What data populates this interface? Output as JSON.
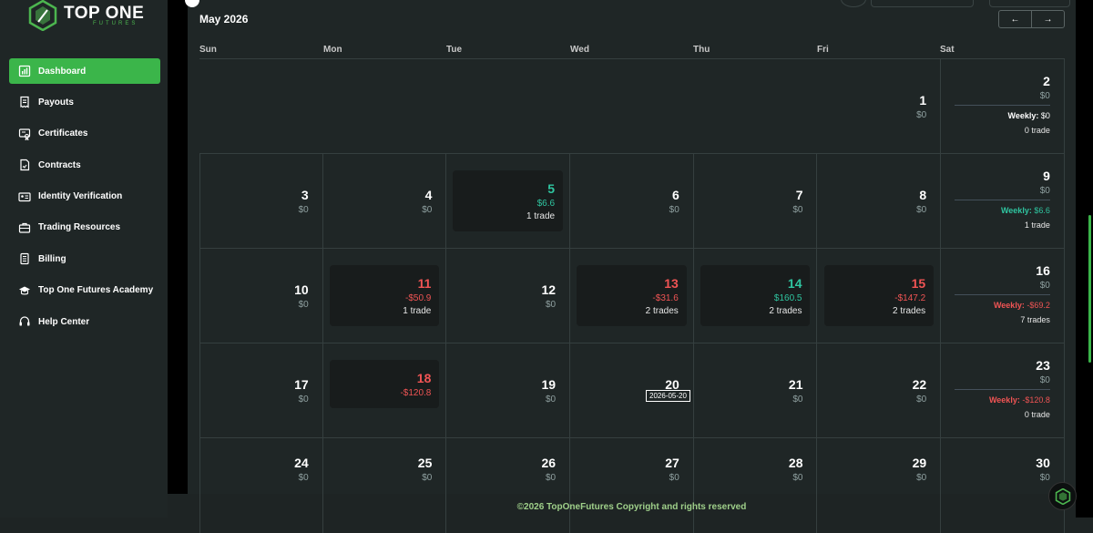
{
  "brand": {
    "name": "TOP ONE",
    "subtitle": "FUTURES"
  },
  "sidebar": {
    "items": [
      {
        "label": "Dashboard",
        "icon": "chart-icon",
        "active": true
      },
      {
        "label": "Payouts",
        "icon": "receipt-icon"
      },
      {
        "label": "Certificates",
        "icon": "certificate-icon"
      },
      {
        "label": "Contracts",
        "icon": "contract-icon"
      },
      {
        "label": "Identity Verification",
        "icon": "id-card-icon"
      },
      {
        "label": "Trading Resources",
        "icon": "briefcase-icon"
      },
      {
        "label": "Billing",
        "icon": "bill-icon"
      },
      {
        "label": "Top One Futures Academy",
        "icon": "graduation-cap-icon"
      },
      {
        "label": "Help Center",
        "icon": "headset-icon"
      }
    ]
  },
  "calendar": {
    "month": "May 2026",
    "prev_label": "←",
    "next_label": "→",
    "weekdays": [
      "Sun",
      "Mon",
      "Tue",
      "Wed",
      "Thu",
      "Fri",
      "Sat"
    ],
    "tooltip": "2026-05-20",
    "weeks": [
      {
        "days": [
          null,
          null,
          null,
          null,
          null,
          {
            "num": "1",
            "amt": "$0"
          },
          {
            "num": "2",
            "amt": "$0",
            "weekly_label": "Weekly:",
            "weekly_value": "$0",
            "trades": "0 trade",
            "status": "flat"
          }
        ]
      },
      {
        "days": [
          {
            "num": "3",
            "amt": "$0"
          },
          {
            "num": "4",
            "amt": "$0"
          },
          {
            "num": "5",
            "amt": "$6.6",
            "trades": "1 trade",
            "status": "pos"
          },
          {
            "num": "6",
            "amt": "$0"
          },
          {
            "num": "7",
            "amt": "$0"
          },
          {
            "num": "8",
            "amt": "$0"
          },
          {
            "num": "9",
            "amt": "$0",
            "weekly_label": "Weekly:",
            "weekly_value": "$6.6",
            "trades": "1 trade",
            "status": "pos"
          }
        ]
      },
      {
        "days": [
          {
            "num": "10",
            "amt": "$0"
          },
          {
            "num": "11",
            "amt": "-$50.9",
            "trades": "1 trade",
            "status": "neg"
          },
          {
            "num": "12",
            "amt": "$0"
          },
          {
            "num": "13",
            "amt": "-$31.6",
            "trades": "2 trades",
            "status": "neg"
          },
          {
            "num": "14",
            "amt": "$160.5",
            "trades": "2 trades",
            "status": "pos"
          },
          {
            "num": "15",
            "amt": "-$147.2",
            "trades": "2 trades",
            "status": "neg"
          },
          {
            "num": "16",
            "amt": "$0",
            "weekly_label": "Weekly:",
            "weekly_value": "-$69.2",
            "trades": "7 trades",
            "status": "neg"
          }
        ]
      },
      {
        "days": [
          {
            "num": "17",
            "amt": "$0"
          },
          {
            "num": "18",
            "amt": "-$120.8",
            "status": "neg"
          },
          {
            "num": "19",
            "amt": "$0"
          },
          {
            "num": "20",
            "amt": ""
          },
          {
            "num": "21",
            "amt": "$0"
          },
          {
            "num": "22",
            "amt": "$0"
          },
          {
            "num": "23",
            "amt": "$0",
            "weekly_label": "Weekly:",
            "weekly_value": "-$120.8",
            "trades": "0 trade",
            "status": "neg"
          }
        ]
      },
      {
        "days": [
          {
            "num": "24",
            "amt": "$0"
          },
          {
            "num": "25",
            "amt": "$0"
          },
          {
            "num": "26",
            "amt": "$0"
          },
          {
            "num": "27",
            "amt": "$0"
          },
          {
            "num": "28",
            "amt": "$0"
          },
          {
            "num": "29",
            "amt": "$0"
          },
          {
            "num": "30",
            "amt": "$0"
          }
        ]
      }
    ]
  },
  "footer": {
    "text": "©2026 TopOneFutures Copyright and rights reserved"
  },
  "colors": {
    "accent": "#3bb54a",
    "positive": "#2fc5a0",
    "negative": "#f05454"
  }
}
